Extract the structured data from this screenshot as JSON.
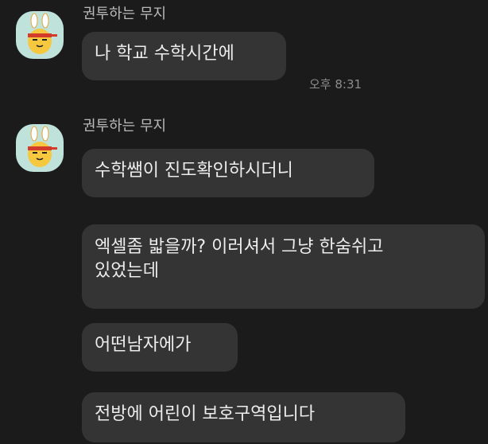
{
  "messages": [
    {
      "sender": "권투하는 무지",
      "bubbles": [
        {
          "text": "나 학교 수학시간에",
          "time": "오후 8:31"
        }
      ]
    },
    {
      "sender": "권투하는 무지",
      "bubbles": [
        {
          "text": "수학쌤이 진도확인하시더니"
        },
        {
          "line1": "엑셀좀 밟을까? 이러셔서 그냥 한숨쉬고",
          "line2": "있었는데"
        },
        {
          "text": "어떤남자에가"
        },
        {
          "text": "전방에 어린이 보호구역입니다"
        }
      ]
    }
  ],
  "colors": {
    "background": "#1b1b1c",
    "bubble": "#343435",
    "bubble_text": "#ededed",
    "sender_text": "#b9b9b9",
    "time_text": "#8d8d8d",
    "avatar_bg": "#bfe3da"
  },
  "icons": {
    "avatar": "muzi-boxing-avatar-icon"
  }
}
